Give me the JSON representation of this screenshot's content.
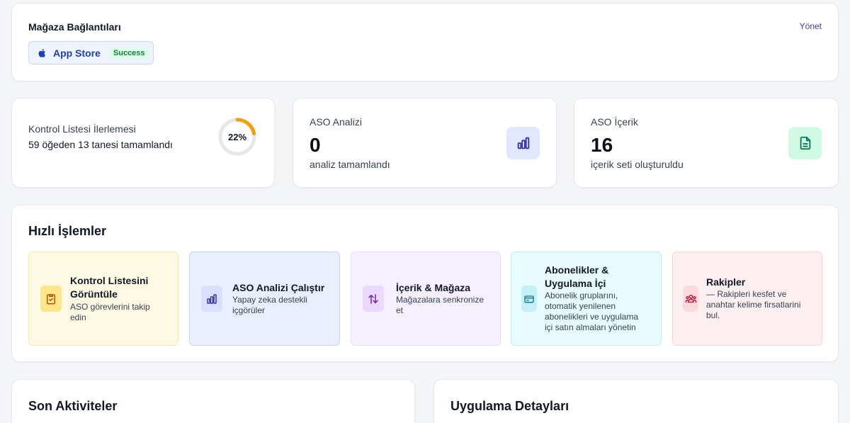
{
  "store_connections": {
    "title": "Mağaza Bağlantıları",
    "manage_label": "Yönet",
    "stores": [
      {
        "name": "App Store",
        "status": "Success",
        "icon": "apple-icon"
      }
    ]
  },
  "stats": {
    "checklist": {
      "label": "Kontrol Listesi İlerlemesi",
      "sub": "59 öğeden 13 tanesi tamamlandı",
      "percent_label": "22%",
      "progress_fraction": 0.22,
      "ring_color": "#f59e0b"
    },
    "aso_analysis": {
      "label": "ASO Analizi",
      "value": "0",
      "desc": "analiz tamamlandı",
      "icon": "bar-chart-icon",
      "icon_bg": "#e0e7ff",
      "icon_color": "#3730a3"
    },
    "aso_content": {
      "label": "ASO İçerik",
      "value": "16",
      "desc": "içerik seti oluşturuldu",
      "icon": "document-icon",
      "icon_bg": "#d1fae5",
      "icon_color": "#047857"
    }
  },
  "quick_actions": {
    "title": "Hızlı İşlemler",
    "items": [
      {
        "title_line1": "Kontrol Listesini",
        "title_line2": "Görüntüle",
        "desc_line1": "ASO görevlerini takip",
        "desc_line2": "edin",
        "icon": "clipboard-check-icon",
        "bg": "#fef9e2",
        "border": "#fde9a7",
        "icon_bg": "#fde68a",
        "icon_color": "#b45309"
      },
      {
        "title_line1": "ASO Analizi Çalıştır",
        "desc_line1": "Yapay zeka destekli",
        "desc_line2": "içgörüler",
        "icon": "bar-chart-icon",
        "bg": "#eaefff",
        "border": "#c7d2fe",
        "icon_bg": "#d9e0fd",
        "icon_color": "#3730a3"
      },
      {
        "title_line1": "İçerik & Mağaza",
        "desc_line1": "Mağazalara senkronize",
        "desc_line2": "et",
        "icon": "sync-arrows-icon",
        "bg": "#f6f0fe",
        "border": "#e9dbfd",
        "icon_bg": "#ead9fc",
        "icon_color": "#6b21a8"
      },
      {
        "title_line1": "Abonelikler &",
        "title_line2": "Uygulama İçi",
        "desc_line1": "Abonelik gruplarını,",
        "desc_line2": "otomatik yenilenen",
        "desc_line3": "abonelikleri ve uygulama",
        "desc_line4": "içi satın almaları yönetin",
        "icon": "credit-card-icon",
        "bg": "#e8fbfe",
        "border": "#bdeef7",
        "icon_bg": "#c6f0f8",
        "icon_color": "#0e7490"
      },
      {
        "title_line1": "Rakipler",
        "desc_line1": "— Rakipleri kesfet ve",
        "desc_line2": "anahtar kelime firsatlarini",
        "desc_line3": "bul.",
        "icon": "users-group-icon",
        "bg": "#feeff0",
        "border": "#fbd3d6",
        "icon_bg": "#fcd9dc",
        "icon_color": "#be123c"
      }
    ]
  },
  "recent_activity": {
    "title": "Son Aktiviteler"
  },
  "app_details": {
    "title": "Uygulama Detayları"
  }
}
